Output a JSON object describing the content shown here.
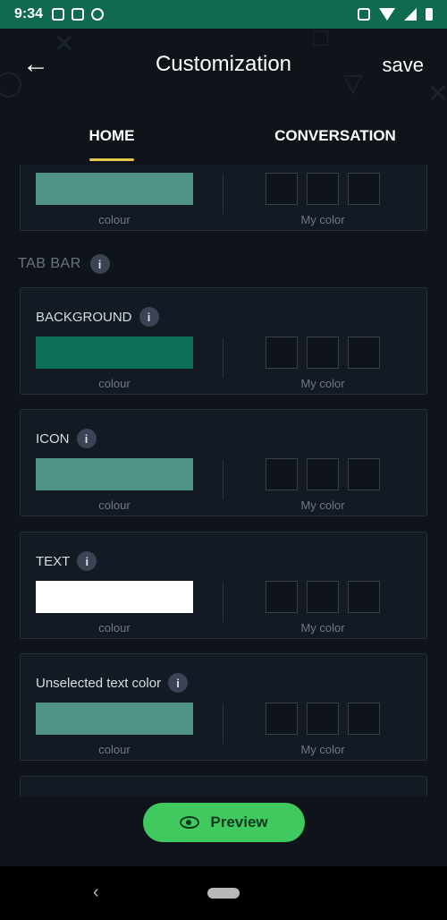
{
  "status_bar": {
    "time": "9:34",
    "left_icons": [
      "message-icon",
      "calendar-icon",
      "data-saver-icon"
    ],
    "right_icons": [
      "vibrate-icon",
      "wifi-icon",
      "signal-icon",
      "battery-icon"
    ],
    "background_color": "#0f6a4f"
  },
  "header": {
    "title": "Customization",
    "save_label": "save",
    "back_icon": "arrow-left-icon"
  },
  "tabs": [
    {
      "label": "HOME",
      "active": true
    },
    {
      "label": "CONVERSATION",
      "active": false
    }
  ],
  "partial_card": {
    "swatch_color": "#4f9384",
    "swatch_caption": "colour",
    "my_color_caption": "My color"
  },
  "tab_bar_section": {
    "heading": "TAB BAR",
    "info_glyph": "i",
    "cards": [
      {
        "label": "BACKGROUND",
        "swatch_color": "#0d6f56",
        "swatch_caption": "colour",
        "my_color_caption": "My color"
      },
      {
        "label": "ICON",
        "swatch_color": "#4f9384",
        "swatch_caption": "colour",
        "my_color_caption": "My color"
      },
      {
        "label": "TEXT",
        "swatch_color": "#ffffff",
        "swatch_caption": "colour",
        "my_color_caption": "My color"
      },
      {
        "label": "Unselected text color",
        "swatch_color": "#4f9384",
        "swatch_caption": "colour",
        "my_color_caption": "My color"
      }
    ]
  },
  "preview_button": {
    "label": "Preview",
    "icon": "eye-icon",
    "color": "#3fc95e"
  },
  "nav_bar": {
    "back_glyph": "‹"
  },
  "accent_colors": {
    "tab_indicator": "#e7c64a",
    "background": "#0f141b"
  }
}
